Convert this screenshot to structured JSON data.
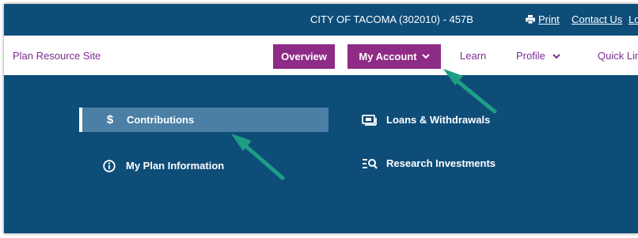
{
  "header": {
    "account_name": "CITY OF TACOMA (302010) - 457B",
    "print_label": "Print",
    "contact_label": "Contact Us",
    "logout_label": "Lo"
  },
  "nav": {
    "site_title": "Plan Resource Site",
    "overview_label": "Overview",
    "my_account_label": "My Account",
    "learn_label": "Learn",
    "profile_label": "Profile",
    "quick_links_label": "Quick Lir"
  },
  "menu": {
    "contributions_label": "Contributions",
    "plan_info_label": "My Plan Information",
    "loans_label": "Loans & Withdrawals",
    "research_label": "Research Investments"
  },
  "icons": {
    "contributions": "dollar-icon",
    "plan_info": "info-circle-icon",
    "loans": "money-bill-icon",
    "research": "list-search-icon",
    "print": "printer-icon",
    "caret": "chevron-down-icon",
    "annotation": "arrow-annotation"
  },
  "colors": {
    "primary_blue": "#0e4d78",
    "active_item": "#4b7fa5",
    "accent_purple": "#8e2b86",
    "link_purple": "#7b2d8e",
    "annotation_green": "#1e9e84"
  }
}
